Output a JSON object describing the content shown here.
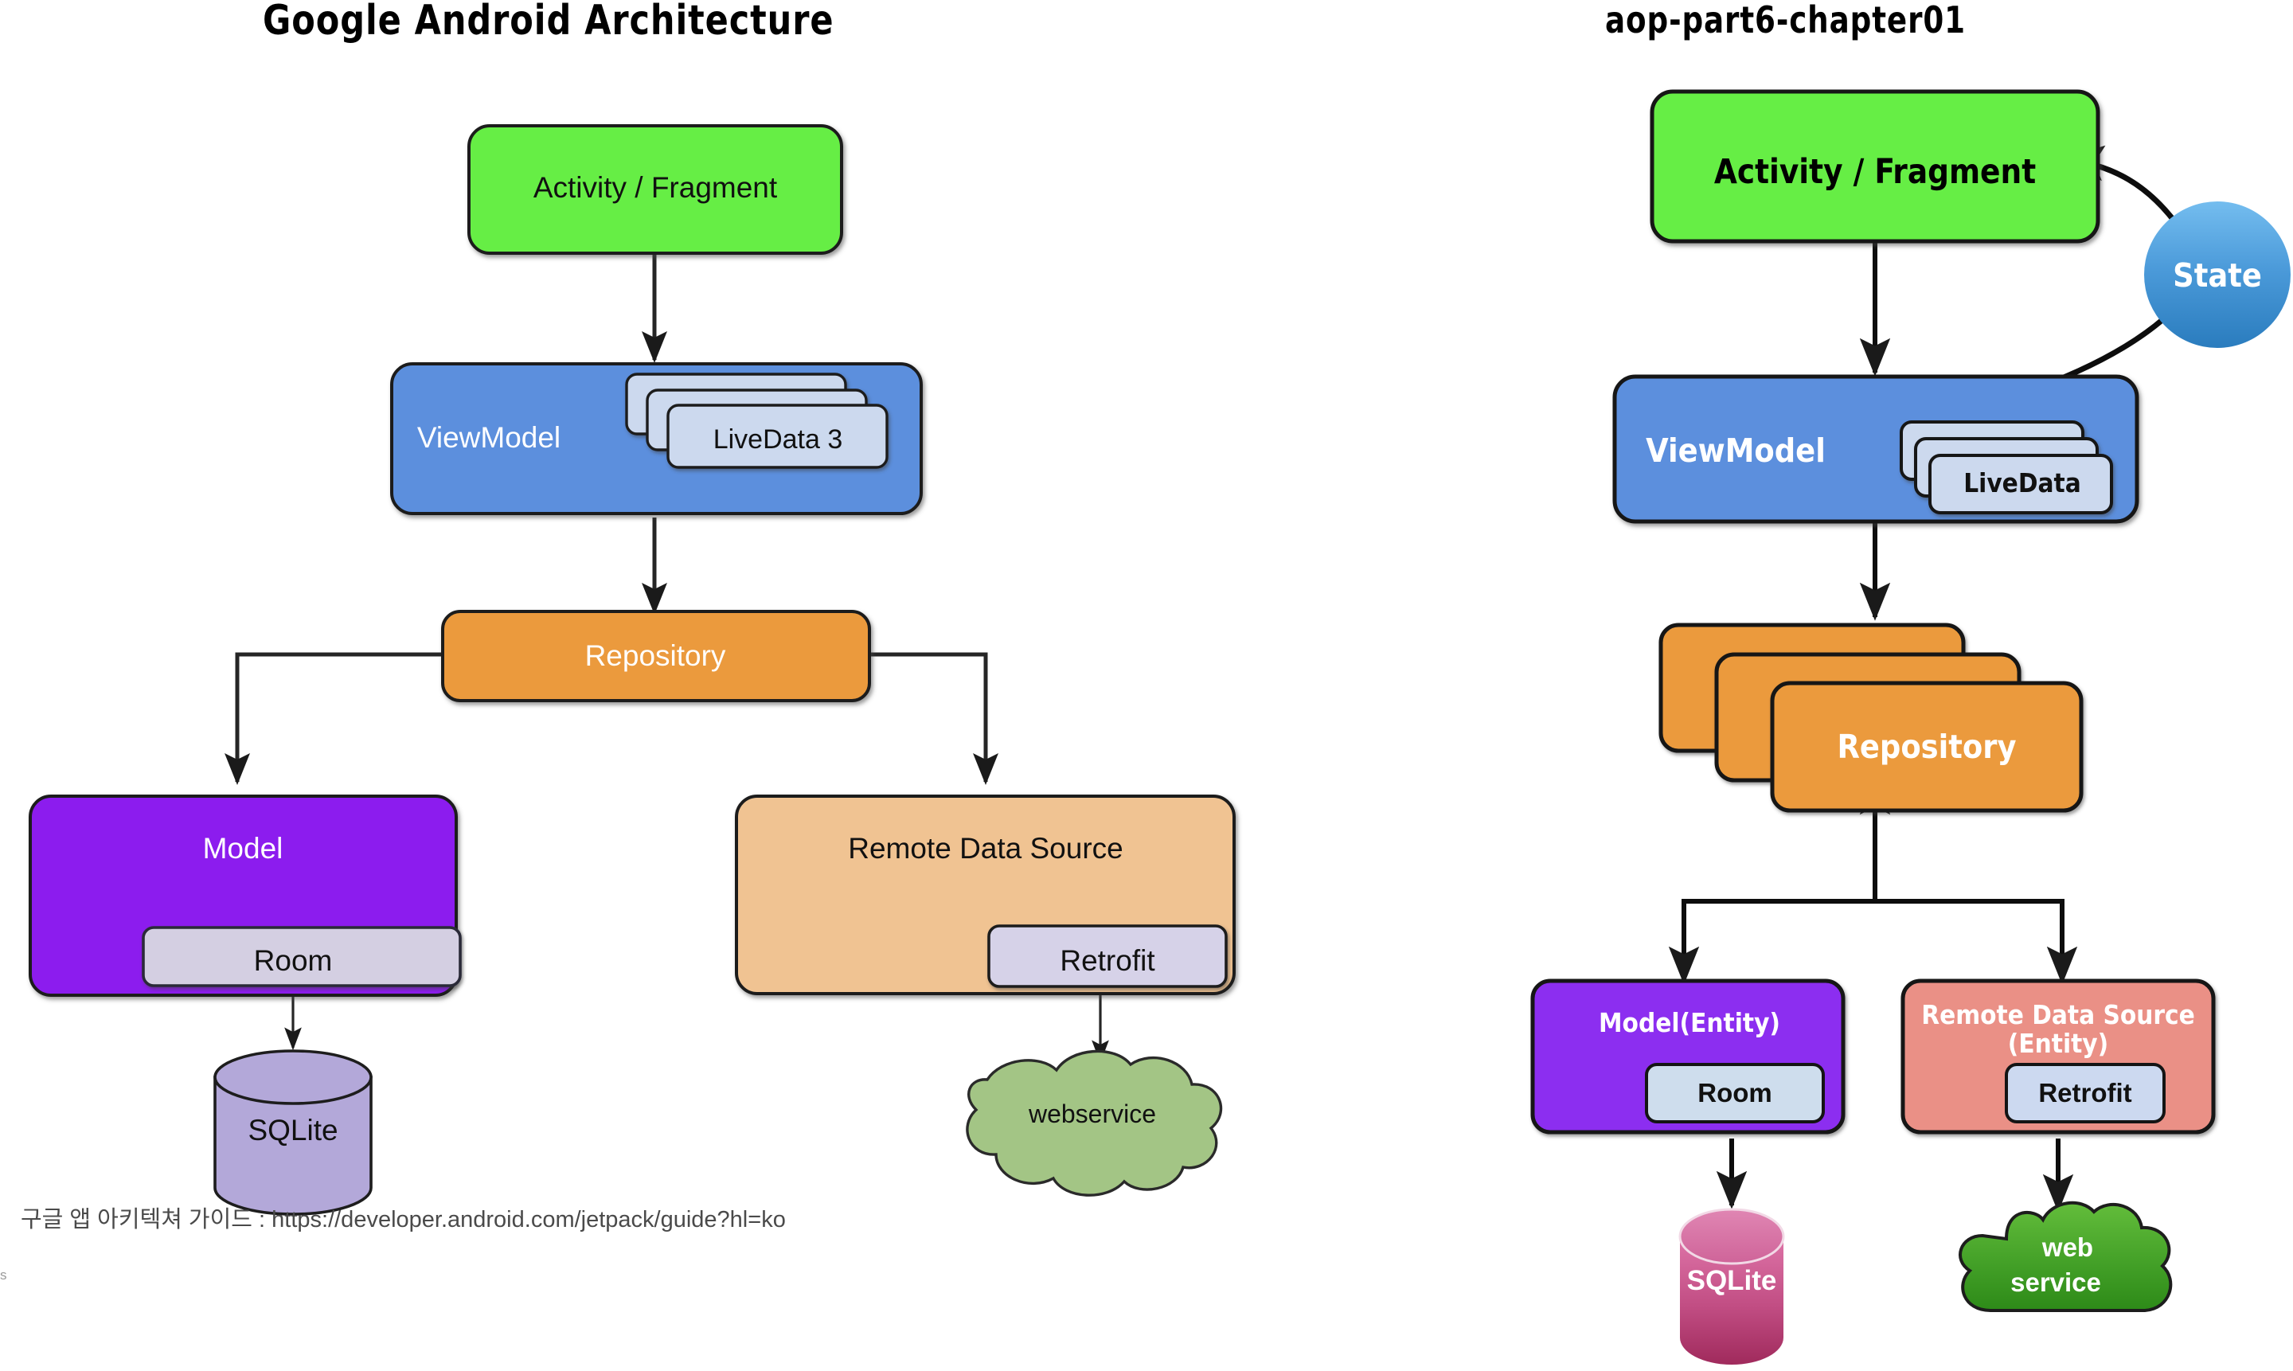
{
  "page": {
    "background": "#ffffff",
    "stray_text": "s"
  },
  "left_diagram": {
    "title": "Google Android Architecture",
    "caption": "구글 앱 아키텍쳐 가이드 : https://developer.android.com/jetpack/guide?hl=ko",
    "nodes": {
      "activity": {
        "label": "Activity / Fragment",
        "fill": "#66ee44",
        "text_color": "#111111"
      },
      "viewmodel": {
        "label": "ViewModel",
        "fill": "#5b8fdd",
        "text_color": "#ffffff"
      },
      "livedata": {
        "label": "LiveData 3",
        "fill": "#ccd9ee",
        "text_color": "#111111",
        "stack_count": 3
      },
      "repository": {
        "label": "Repository",
        "fill": "#eb9a3c",
        "text_color": "#ffffff"
      },
      "model": {
        "label": "Model",
        "fill": "#8c1aee",
        "text_color": "#ffffff"
      },
      "room": {
        "label": "Room",
        "fill": "#d4cfe2",
        "text_color": "#111111"
      },
      "remote_data_source": {
        "label": "Remote Data Source",
        "fill": "#f0c392",
        "text_color": "#111111"
      },
      "retrofit": {
        "label": "Retrofit",
        "fill": "#d6d2e8",
        "text_color": "#111111"
      },
      "sqlite": {
        "label": "SQLite",
        "fill": "#b3a8d9",
        "text_color": "#111111"
      },
      "webservice": {
        "label": "webservice",
        "fill": "#a3c585",
        "text_color": "#111111"
      }
    }
  },
  "right_diagram": {
    "title": "aop-part6-chapter01",
    "nodes": {
      "activity": {
        "label": "Activity / Fragment",
        "fill": "#66ee44",
        "text_color": "#000000"
      },
      "state": {
        "label": "State",
        "fill_top": "#6cb4e8",
        "fill_bottom": "#2d82c4",
        "text_color": "#ffffff"
      },
      "viewmodel": {
        "label": "ViewModel",
        "fill": "#5b8fdd",
        "text_color": "#ffffff"
      },
      "livedata": {
        "label": "LiveData",
        "fill": "#ccd9ee",
        "text_color": "#111111",
        "stack_count": 3
      },
      "repository": {
        "label": "Repository",
        "fill": "#eb9a3c",
        "text_color": "#ffffff",
        "stack_count": 3
      },
      "model_entity": {
        "label": "Model(Entity)",
        "fill": "#8c2ff0",
        "text_color": "#ffffff"
      },
      "room": {
        "label": "Room",
        "fill": "#cedded",
        "text_color": "#111111"
      },
      "remote_data_source": {
        "label_line1": "Remote Data Source",
        "label_line2": "(Entity)",
        "fill": "#ea9086",
        "text_color": "#ffffff"
      },
      "retrofit": {
        "label": "Retrofit",
        "fill": "#ccd9f0",
        "text_color": "#111111"
      },
      "sqlite": {
        "label": "SQLite",
        "fill_top": "#d9679f",
        "fill_bottom": "#a62b5e",
        "text_color": "#ffffff"
      },
      "webservice": {
        "label_line1": "web",
        "label_line2": "service",
        "fill_top": "#5bb535",
        "fill_bottom": "#2f8c1e",
        "text_color": "#ffffff"
      }
    }
  }
}
